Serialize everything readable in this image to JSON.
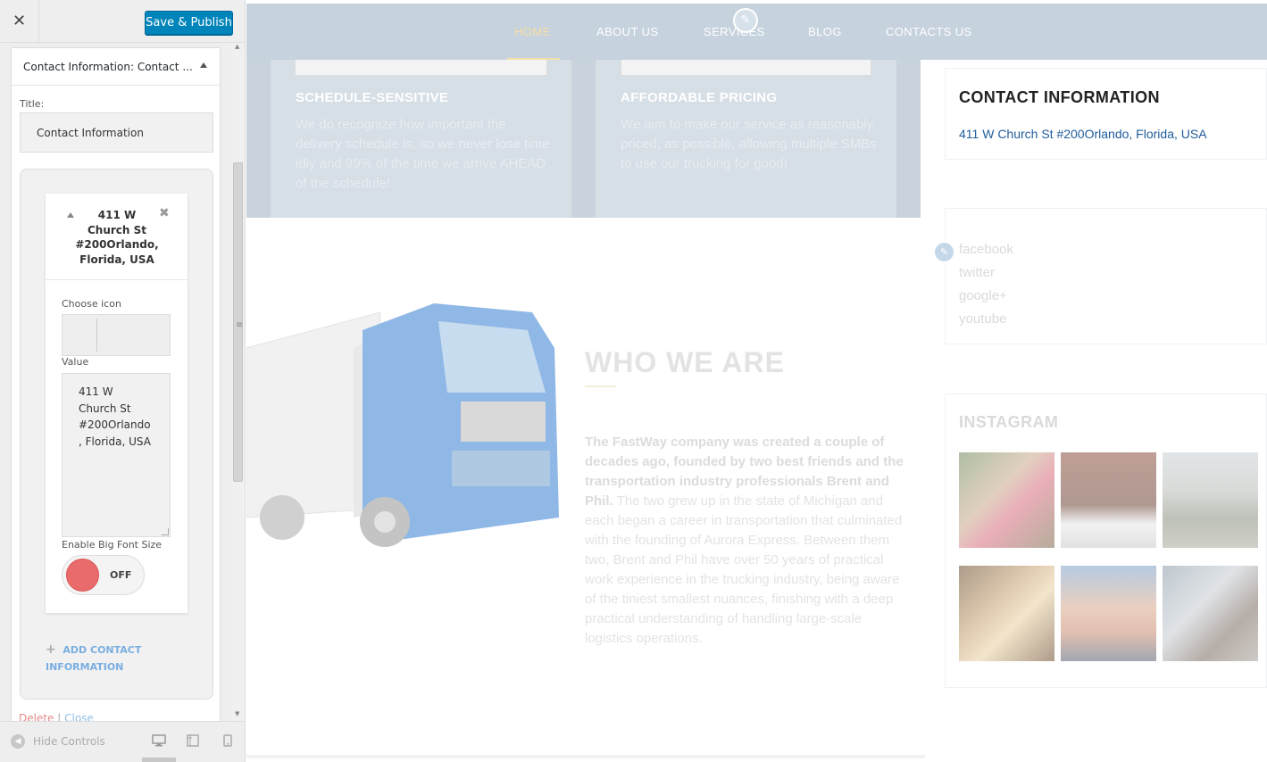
{
  "panel": {
    "close_label": "✕",
    "publish_label": "Save & Publish",
    "section_title": "Contact Information: Contact ...",
    "title_label": "Title:",
    "title_value": "Contact Information",
    "item": {
      "title": "411 W Church St #200Orlando, Florida, USA",
      "remove_icon": "✖",
      "choose_icon_label": "Choose icon",
      "value_label": "Value",
      "value": "411 W Church St #200Orlando, Florida, USA",
      "big_font_label": "Enable Big Font Size",
      "toggle_state": "OFF"
    },
    "add_contact_label": "ADD CONTACT INFORMATION",
    "delete_label": "Delete",
    "separator": "|",
    "close_link_label": "Close",
    "hide_controls_label": "Hide Controls",
    "scroll_grip": "≡"
  },
  "preview": {
    "nav": {
      "items": [
        "HOME",
        "ABOUT US",
        "SERVICES",
        "BLOG",
        "CONTACTS US"
      ],
      "active_color": "#f4dfa6"
    },
    "features": [
      {
        "title": "SCHEDULE-SENSITIVE",
        "text": "We do recognize how important the delivery schedule is, so we never lose time idly and 99% of the time we arrive AHEAD of the schedule!"
      },
      {
        "title": "AFFORDABLE PRICING",
        "text": "We aim to make our service as reasonably priced, as possible, allowing multiple SMBs to use our trucking for good!"
      }
    ],
    "who": {
      "title": "WHO WE ARE",
      "bold_text": "The FastWay company was created a couple of decades ago, founded by two best  friends and the transportation industry professionals Brent and Phil.",
      "text": " The two grew up in the state of Michigan and each began a career in transportation that culminated with the founding of Aurora Express. Between them two, Brent and Phil have over 50 years of practical work experience in the trucking industry, being aware of the tiniest smallest nuances, finishing with a deep practical understanding of handling large-scale logistics operations."
    },
    "contact_widget": {
      "title": "CONTACT INFORMATION",
      "address": "411 W Church St #200Orlando, Florida, USA"
    },
    "social": [
      "facebook",
      "twitter",
      "google+",
      "youtube"
    ],
    "instagram_title": "INSTAGRAM"
  }
}
